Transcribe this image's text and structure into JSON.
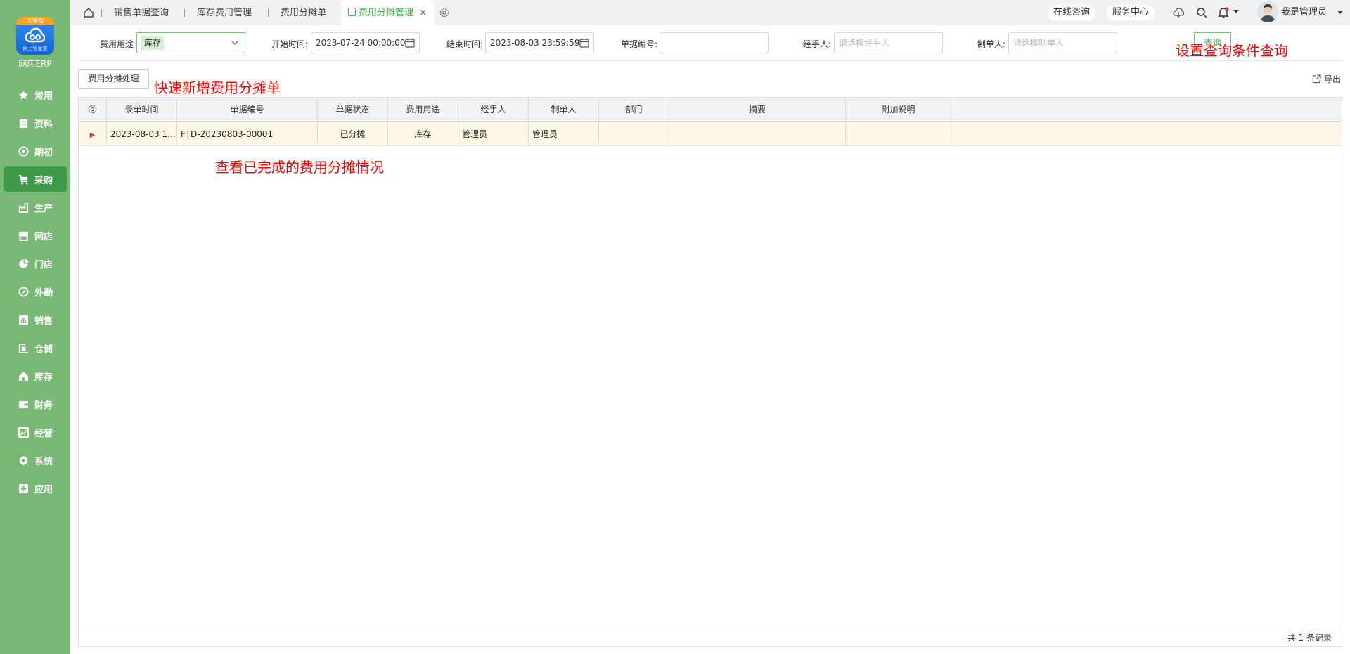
{
  "app": {
    "logo_badge": "大掌柜",
    "logo_sub": "网上管家婆",
    "name": "网店ERP"
  },
  "sidebar": {
    "items": [
      {
        "label": "常用",
        "icon": "star-icon"
      },
      {
        "label": "资料",
        "icon": "document-icon"
      },
      {
        "label": "期初",
        "icon": "target-icon"
      },
      {
        "label": "采购",
        "icon": "cart-icon",
        "active": true
      },
      {
        "label": "生产",
        "icon": "factory-icon"
      },
      {
        "label": "网店",
        "icon": "store-icon"
      },
      {
        "label": "门店",
        "icon": "pie-icon"
      },
      {
        "label": "外勤",
        "icon": "compass-icon"
      },
      {
        "label": "销售",
        "icon": "bar-chart-icon"
      },
      {
        "label": "仓储",
        "icon": "warehouse-icon"
      },
      {
        "label": "库存",
        "icon": "home-stock-icon"
      },
      {
        "label": "财务",
        "icon": "wallet-icon"
      },
      {
        "label": "经营",
        "icon": "trend-icon"
      },
      {
        "label": "系统",
        "icon": "hexagon-icon"
      },
      {
        "label": "应用",
        "icon": "plus-box-icon"
      }
    ]
  },
  "tabs": [
    {
      "label": "销售单据查询"
    },
    {
      "label": "库存费用管理"
    },
    {
      "label": "费用分摊单"
    },
    {
      "label": "费用分摊管理",
      "active": true,
      "close": "×"
    }
  ],
  "header": {
    "consult": "在线咨询",
    "service": "服务中心",
    "user": "我是管理员"
  },
  "filters": {
    "purpose_label": "费用用途",
    "purpose_value": "库存",
    "start_label": "开始时间:",
    "start_value": "2023-07-24 00:00:00",
    "end_label": "结束时间:",
    "end_value": "2023-08-03 23:59:59",
    "number_label": "单据编号:",
    "number_value": "",
    "handler_label": "经手人:",
    "handler_placeholder": "请选择经手人",
    "creator_label": "制单人:",
    "creator_placeholder": "请选择制单人",
    "query_button": "查询"
  },
  "annotations": {
    "query_hint": "设置查询条件查询",
    "add_hint": "快速新增费用分摊单",
    "view_hint": "查看已完成的费用分摊情况"
  },
  "toolbar": {
    "process_button": "费用分摊处理",
    "export_label": "导出"
  },
  "table": {
    "columns": [
      "录单时间",
      "单据编号",
      "单据状态",
      "费用用途",
      "经手人",
      "制单人",
      "部门",
      "摘要",
      "附加说明"
    ],
    "rows": [
      [
        "2023-08-03 1...",
        "FTD-20230803-00001",
        "已分摊",
        "库存",
        "管理员",
        "管理员",
        "",
        "",
        ""
      ]
    ],
    "footer": "共 1 条记录"
  },
  "colors": {
    "sidebar_bg": "#78b874",
    "sidebar_active": "#3e9b4a",
    "accent": "#4caf50",
    "row_highlight": "#fdf8e6",
    "annotation": "#ff0000"
  }
}
